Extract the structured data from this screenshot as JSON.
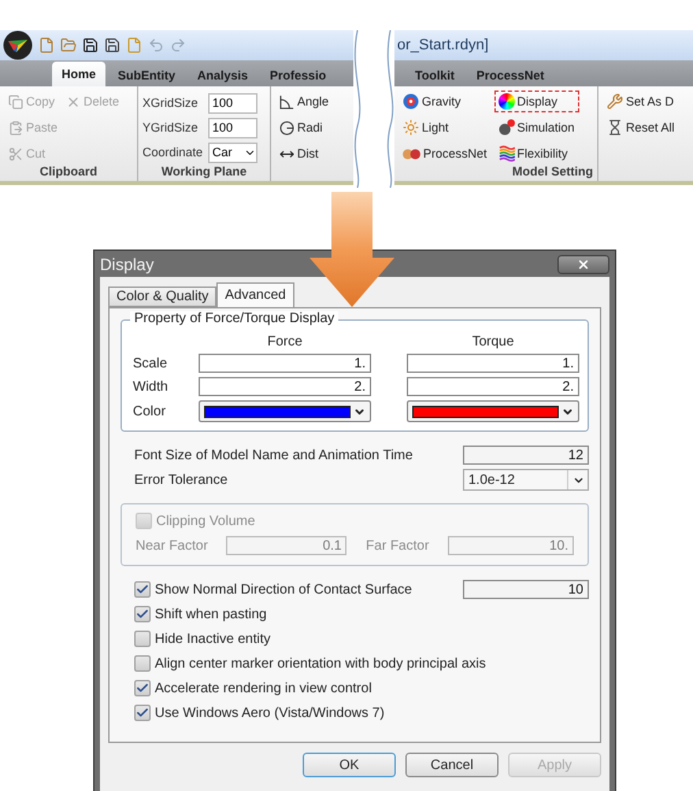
{
  "ribbon_left": {
    "tabs": [
      {
        "label": "Home",
        "selected": true
      },
      {
        "label": "SubEntity",
        "selected": false
      },
      {
        "label": "Analysis",
        "selected": false
      },
      {
        "label": "Professio",
        "selected": false
      }
    ],
    "clipboard": {
      "label": "Clipboard",
      "buttons": [
        {
          "label": "Copy",
          "disabled": true
        },
        {
          "label": "Delete",
          "disabled": true
        },
        {
          "label": "Paste",
          "disabled": true
        },
        {
          "label": "Cut",
          "disabled": true
        }
      ]
    },
    "working_plane": {
      "label": "Working Plane",
      "fields": [
        {
          "label": "XGridSize",
          "value": "100",
          "kind": "text"
        },
        {
          "label": "YGridSize",
          "value": "100",
          "kind": "text"
        },
        {
          "label": "Coordinate",
          "value": "Car",
          "kind": "dropdown"
        }
      ]
    },
    "measure": {
      "buttons": [
        {
          "label": "Angle"
        },
        {
          "label": "Radi"
        },
        {
          "label": "Dist"
        }
      ]
    }
  },
  "ribbon_right": {
    "title": "or_Start.rdyn]",
    "tabs": [
      {
        "label": "Toolkit",
        "selected": false
      },
      {
        "label": "ProcessNet",
        "selected": false
      }
    ],
    "model_setting": {
      "label": "Model Setting",
      "buttons": [
        {
          "label": "Gravity",
          "highlighted": false
        },
        {
          "label": "Light",
          "highlighted": false
        },
        {
          "label": "ProcessNet",
          "highlighted": false
        },
        {
          "label": "Display",
          "highlighted": true
        },
        {
          "label": "Simulation",
          "highlighted": false
        },
        {
          "label": "Flexibility",
          "highlighted": false
        }
      ]
    },
    "defaults": {
      "buttons": [
        {
          "label": "Set As D"
        },
        {
          "label": "Reset All"
        }
      ]
    }
  },
  "dialog": {
    "title": "Display",
    "tabs": [
      {
        "label": "Color & Quality",
        "selected": false
      },
      {
        "label": "Advanced",
        "selected": true
      }
    ],
    "force_torque": {
      "title": "Property of Force/Torque Display",
      "columns": [
        "Force",
        "Torque"
      ],
      "rows": [
        {
          "label": "Scale",
          "kind": "text",
          "values": [
            "1.",
            "1."
          ]
        },
        {
          "label": "Width",
          "kind": "text",
          "values": [
            "2.",
            "2."
          ]
        },
        {
          "label": "Color",
          "kind": "color",
          "swatches": [
            {
              "color": "#0000ff"
            },
            {
              "color": "#ff0000"
            }
          ]
        }
      ]
    },
    "font_size": {
      "label": "Font Size of Model Name and Animation Time",
      "value": "12"
    },
    "error_tolerance": {
      "label": "Error Tolerance",
      "value": "1.0e-12"
    },
    "clipping": {
      "label": "Clipping Volume",
      "checked": false,
      "disabled": true,
      "near": {
        "label": "Near Factor",
        "value": "0.1"
      },
      "far": {
        "label": "Far Factor",
        "value": "10."
      }
    },
    "options": [
      {
        "label": "Show Normal Direction of Contact Surface",
        "checked": true,
        "value": "10"
      },
      {
        "label": "Shift when pasting",
        "checked": true
      },
      {
        "label": "Hide Inactive entity",
        "checked": false
      },
      {
        "label": "Align center marker orientation with body principal axis",
        "checked": false
      },
      {
        "label": "Accelerate rendering in view control",
        "checked": true
      },
      {
        "label": "Use Windows Aero (Vista/Windows 7)",
        "checked": true
      }
    ],
    "buttons": [
      {
        "label": "OK",
        "focused": true,
        "disabled": false
      },
      {
        "label": "Cancel",
        "focused": false,
        "disabled": false
      },
      {
        "label": "Apply",
        "focused": false,
        "disabled": true
      }
    ]
  }
}
